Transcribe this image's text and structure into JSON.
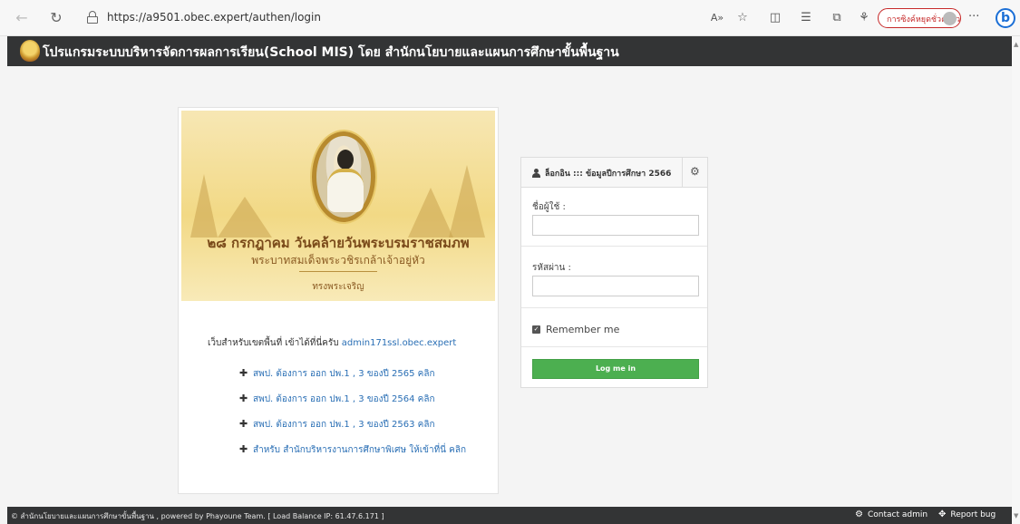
{
  "browser": {
    "url": "https://a9501.obec.expert/authen/login",
    "sync_label": "การซิงค์หยุดชั่วคราว",
    "more_label": "···",
    "bing_label": "b"
  },
  "header": {
    "title": "โปรแกรมระบบบริหารจัดการผลการเรียน(School MIS) โดย สำนักนโยบายและแผนการศึกษาขั้นพื้นฐาน"
  },
  "banner": {
    "line1": "๒๘ กรกฎาคม วันคล้ายวันพระบรมราชสมภพ",
    "line2": "พระบาทสมเด็จพระวชิรเกล้าเจ้าอยู่หัว",
    "sign": "ทรงพระเจริญ"
  },
  "info": {
    "text": "เว็บสำหรับเขตพื้นที่ เข้าได้ที่นี่ครับ ",
    "link": "admin171ssl.obec.expert"
  },
  "links": [
    "สพป. ต้องการ ออก ปพ.1 , 3  ของปี 2565 คลิก",
    "สพป. ต้องการ ออก ปพ.1 , 3  ของปี 2564 คลิก",
    "สพป. ต้องการ ออก ปพ.1 , 3  ของปี 2563 คลิก",
    "สำหรับ สำนักบริหารงานการศึกษาพิเศษ ให้เข้าที่นี่ คลิก"
  ],
  "login": {
    "title": "ล็อกอิน ::: ข้อมูลปีการศึกษา 2566",
    "username_label": "ชื่อผู้ใช้ :",
    "username_value": "",
    "password_label": "รหัสผ่าน :",
    "password_value": "",
    "remember_label": "Remember me",
    "remember_checked": true,
    "button_label": "Log me in"
  },
  "footer": {
    "text": "© สำนักนโยบายและแผนการศึกษาขั้นพื้นฐาน , powered by Phayoune Team. [ Load Balance IP: 61.47.6.171 ]",
    "contact": "Contact admin",
    "report": "Report bug"
  },
  "colors": {
    "header_bg": "#333435",
    "login_button": "#4caf50",
    "link": "#2a6fb5",
    "sync_pill": "#c62828"
  }
}
